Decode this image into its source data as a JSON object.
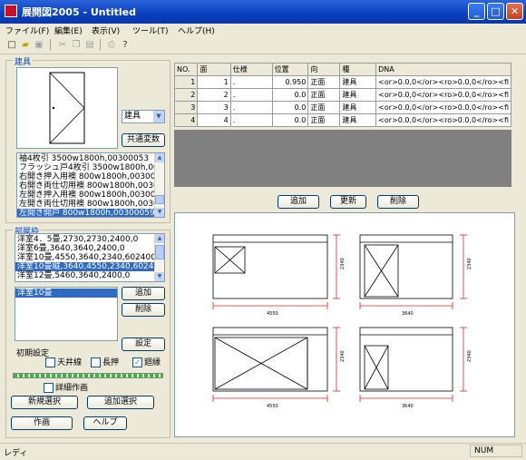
{
  "window": {
    "title": "展開図2005 - Untitled"
  },
  "menu": [
    "ファイル(F)",
    "編集(E)",
    "表示(V)",
    "ツール(T)",
    "ヘルプ(H)"
  ],
  "toolbar": [
    "new-file-icon",
    "open-folder-icon",
    "save-icon",
    "cut-icon",
    "copy-icon",
    "paste-icon",
    "print-icon",
    "help-icon"
  ],
  "fitting_group": {
    "label": "建具",
    "category_select": "建具",
    "common_vars_button": "共通変数",
    "items": [
      "袖4枚引 3500w1800h,00300053",
      "フラッシュ戸4枚引 3500w1800h,00300",
      "右開き押入用襖 800w1800h,0030005",
      "右開き両仕切用襖 800w1800h,003000",
      "左開き押入用襖 800w1800h,00300055",
      "左開き両仕切用襖 800w1800h,003000",
      "左開き開戸 800w1800h,00300059",
      "右開き開戸 800w1800h,00300060"
    ],
    "selected_index": 6
  },
  "room_group": {
    "label": "部屋枠",
    "items": [
      "洋室4．5畳,2730,2730,2400,0",
      "洋室6畳,3640,3640,2400,0",
      "洋室10畳,4550,3640,2340,602400,0",
      "洋室10畳縦,3640,4550,2340,602400",
      "洋室12畳,5460,3640,2400,0"
    ],
    "selected_index": 3
  },
  "selected_rooms": {
    "items": [
      "洋室10畳"
    ],
    "add_button": "追加",
    "delete_button": "削除",
    "settings_button": "設定"
  },
  "initial_settings": {
    "label": "初期設定",
    "checkboxes": [
      {
        "label": "天井線",
        "checked": false
      },
      {
        "label": "長押",
        "checked": false
      },
      {
        "label": "廻縁",
        "checked": true
      }
    ],
    "progress": 1.0,
    "detail_checkbox": {
      "label": "詳細作画",
      "checked": false
    }
  },
  "buttons": {
    "new_select": "新規選択",
    "add_select": "追加選択",
    "draw": "作画",
    "help": "ヘルプ"
  },
  "grid": {
    "columns": [
      "NO.",
      "面",
      "仕様",
      "位置",
      "向",
      "種",
      "DNA"
    ],
    "rows": [
      [
        "1",
        "1",
        ".",
        "0.950",
        "正面",
        "建具",
        "<or>0.0,0</or><ro>0.0,0</ro><fi"
      ],
      [
        "2",
        "2",
        ".",
        "0.0",
        "正面",
        "建具",
        "<or>0.0,0</or><ro>0.0,0</ro><fi"
      ],
      [
        "3",
        "3",
        ".",
        "0.0",
        "正面",
        "建具",
        "<or>0.0,0</or><ro>0.0,0</ro><fi"
      ],
      [
        "4",
        "4",
        ".",
        "0.0",
        "正面",
        "建具",
        "<or>0.0,0</or><ro>0.0,0</ro><fi"
      ]
    ]
  },
  "grid_buttons": {
    "add": "追加",
    "update": "更新",
    "delete": "削除"
  },
  "drawing": {
    "dims_top": [
      "4550",
      "3640"
    ],
    "dims_bottom": [
      "4550",
      "3640"
    ],
    "heights": [
      "2340",
      "2340",
      "2340",
      "2340"
    ]
  },
  "status": {
    "left": "レディ",
    "num": "NUM"
  }
}
